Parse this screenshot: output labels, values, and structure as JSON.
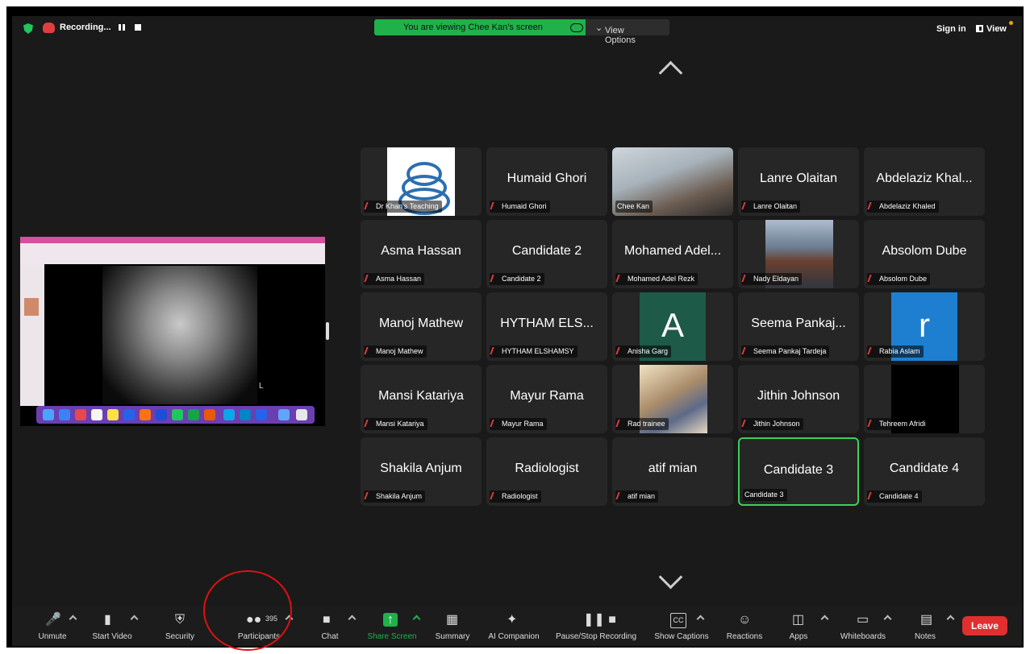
{
  "recording": {
    "label": "Recording..."
  },
  "banner": {
    "text": "You are viewing Chee Kan's screen",
    "view_options": "View Options"
  },
  "topright": {
    "sign_in": "Sign in",
    "view": "View"
  },
  "shared_screen": {
    "xray_marker": "L"
  },
  "tiles": [
    {
      "big": "",
      "name": "Dr Khan's Teaching",
      "type": "lungs",
      "muted": true
    },
    {
      "big": "Humaid Ghori",
      "name": "Humaid Ghori",
      "muted": true
    },
    {
      "big": "",
      "name": "Chee Kan",
      "type": "face",
      "muted": false
    },
    {
      "big": "Lanre Olaitan",
      "name": "Lanre Olaitan",
      "muted": true
    },
    {
      "big": "Abdelaziz Khal...",
      "name": "Abdelaziz Khaled",
      "muted": true
    },
    {
      "big": "Asma Hassan",
      "name": "Asma Hassan",
      "muted": true
    },
    {
      "big": "Candidate 2",
      "name": "Candidate 2",
      "muted": true
    },
    {
      "big": "Mohamed Adel...",
      "name": "Mohamed Adel Rezk",
      "muted": true
    },
    {
      "big": "",
      "name": "Nady Eldayan",
      "type": "photo",
      "muted": true
    },
    {
      "big": "Absolom Dube",
      "name": "Absolom Dube",
      "muted": true
    },
    {
      "big": "Manoj Mathew",
      "name": "Manoj Mathew",
      "muted": true
    },
    {
      "big": "HYTHAM ELS...",
      "name": "HYTHAM ELSHAMSY",
      "muted": true
    },
    {
      "big": "",
      "name": "Anisha Garg",
      "type": "letter",
      "letter": "A",
      "color": "#1e5a48",
      "muted": true
    },
    {
      "big": "Seema Pankaj...",
      "name": "Seema Pankaj Tardeja",
      "muted": true
    },
    {
      "big": "",
      "name": "Rabia Aslam",
      "type": "letter",
      "letter": "r",
      "color": "#1e7fd0",
      "muted": true
    },
    {
      "big": "Mansi Katariya",
      "name": "Mansi Katariya",
      "muted": true
    },
    {
      "big": "Mayur Rama",
      "name": "Mayur Rama",
      "muted": true
    },
    {
      "big": "",
      "name": "Rad trainee",
      "type": "painting",
      "muted": true
    },
    {
      "big": "Jithin Johnson",
      "name": "Jithin Johnson",
      "muted": true
    },
    {
      "big": "",
      "name": "Tehreem Afridi",
      "type": "dark",
      "muted": true
    },
    {
      "big": "Shakila Anjum",
      "name": "Shakila Anjum",
      "muted": true
    },
    {
      "big": "Radiologist",
      "name": "Radiologist",
      "muted": true
    },
    {
      "big": "atif mian",
      "name": "atif mian",
      "muted": true
    },
    {
      "big": "Candidate 3",
      "name": "Candidate 3",
      "muted": false,
      "active": true
    },
    {
      "big": "Candidate 4",
      "name": "Candidate 4",
      "muted": true
    }
  ],
  "toolbar": {
    "unmute": "Unmute",
    "start_video": "Start Video",
    "security": "Security",
    "participants": "Participants",
    "participants_count": "395",
    "chat": "Chat",
    "share_screen": "Share Screen",
    "summary": "Summary",
    "ai_companion": "AI Companion",
    "pause_stop_recording": "Pause/Stop Recording",
    "show_captions": "Show Captions",
    "reactions": "Reactions",
    "apps": "Apps",
    "whiteboards": "Whiteboards",
    "notes": "Notes",
    "leave": "Leave",
    "cc_glyph": "CC"
  },
  "colors": {
    "share_green": "#21b14b",
    "leave_red": "#e02f2f",
    "active_border": "#3ecf5a",
    "annotation_red": "#d11111"
  }
}
